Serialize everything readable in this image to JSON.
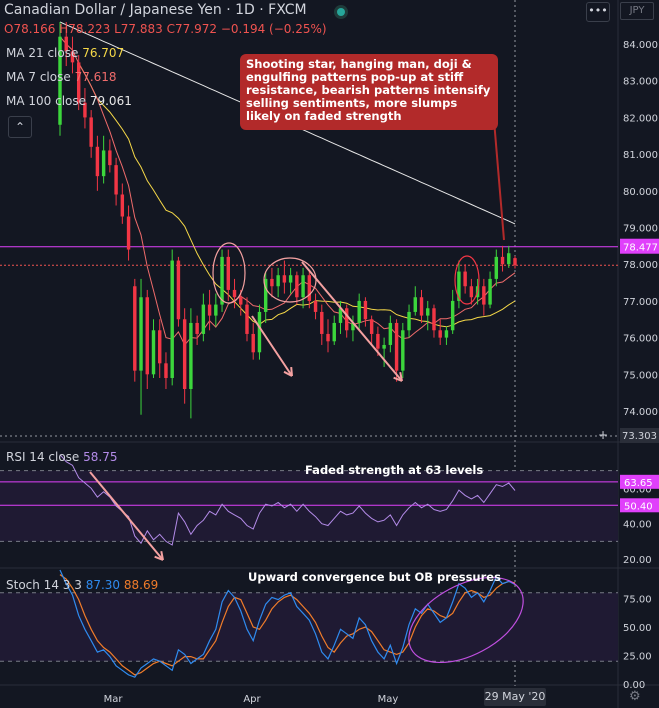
{
  "header": {
    "title": "Canadian Dollar / Japanese Yen · 1D · FXCM",
    "currency": "JPY",
    "ohlc": {
      "o": "O78.166",
      "h": "H78.223",
      "l": "L77.883",
      "c": "C77.972",
      "chg": "−0.194 (−0.25%)"
    }
  },
  "indicators": {
    "ma21": {
      "label": "MA 21 close",
      "value": "76.707",
      "color": "#f5d848"
    },
    "ma7": {
      "label": "MA 7 close",
      "value": "77.618",
      "color": "#ef6b6b"
    },
    "ma100": {
      "label": "MA 100 close",
      "value": "79.061",
      "color": "#e8e8e8"
    },
    "rsi": {
      "label": "RSI 14 close",
      "value": "58.75",
      "color": "#b38be8"
    },
    "stoch": {
      "label": "Stoch 14 3 3",
      "k": "87.30",
      "d": "88.69",
      "k_color": "#2f8bef",
      "d_color": "#f07c2a"
    }
  },
  "annotations": {
    "callout": "Shooting star, hanging man, doji & engulfing patterns pop-up at stiff resistance, bearish patterns intensify selling sentiments, more slumps likely on faded strength",
    "rsi_note": "Faded strength at 63 levels",
    "stoch_note": "Upward convergence but OB pressures"
  },
  "chart_data": [
    {
      "type": "candlestick",
      "pane": "price",
      "y_ticks": [
        "84.000",
        "83.000",
        "82.000",
        "81.000",
        "80.000",
        "79.000",
        "78.000",
        "77.000",
        "76.000",
        "75.000",
        "74.000"
      ],
      "ylim": [
        73.3,
        84.6
      ],
      "price_labels": {
        "resistance": "78.477",
        "low": "73.303"
      },
      "resistance": 78.477,
      "current": 77.972,
      "x_labels": [
        "Mar",
        "Apr",
        "May"
      ],
      "cursor_date": "29 May '20",
      "candles": [
        [
          81.8,
          84.6,
          81.5,
          84.2
        ],
        [
          84.2,
          84.6,
          83.4,
          83.8
        ],
        [
          83.8,
          84.2,
          83.2,
          83.5
        ],
        [
          83.5,
          83.7,
          82.2,
          82.4
        ],
        [
          82.4,
          82.8,
          81.7,
          82.0
        ],
        [
          82.0,
          82.2,
          80.9,
          81.2
        ],
        [
          81.2,
          81.5,
          80.0,
          80.4
        ],
        [
          80.4,
          81.5,
          80.2,
          81.1
        ],
        [
          81.1,
          81.4,
          80.5,
          80.7
        ],
        [
          80.7,
          80.9,
          79.6,
          79.9
        ],
        [
          79.9,
          80.2,
          79.1,
          79.3
        ],
        [
          79.3,
          79.6,
          78.1,
          78.4
        ],
        [
          77.4,
          77.6,
          74.8,
          75.1
        ],
        [
          75.1,
          77.6,
          73.9,
          77.1
        ],
        [
          77.1,
          77.3,
          74.6,
          75.0
        ],
        [
          75.0,
          76.5,
          74.9,
          76.2
        ],
        [
          76.2,
          76.5,
          74.9,
          75.3
        ],
        [
          75.3,
          75.6,
          74.6,
          74.9
        ],
        [
          74.9,
          78.4,
          74.7,
          78.1
        ],
        [
          78.1,
          78.2,
          76.3,
          76.5
        ],
        [
          76.5,
          76.8,
          74.2,
          74.6
        ],
        [
          74.6,
          76.8,
          73.8,
          76.4
        ],
        [
          76.4,
          76.6,
          75.8,
          76.1
        ],
        [
          76.1,
          77.2,
          75.9,
          76.9
        ],
        [
          76.9,
          77.3,
          76.2,
          76.6
        ],
        [
          76.6,
          77.2,
          76.3,
          76.9
        ],
        [
          76.9,
          78.4,
          76.7,
          78.2
        ],
        [
          78.2,
          78.4,
          77.0,
          77.3
        ],
        [
          77.3,
          77.6,
          76.8,
          77.1
        ],
        [
          77.1,
          77.3,
          76.6,
          76.9
        ],
        [
          76.9,
          77.1,
          75.9,
          76.1
        ],
        [
          76.1,
          76.4,
          75.4,
          75.6
        ],
        [
          75.6,
          76.9,
          75.4,
          76.7
        ],
        [
          76.7,
          77.8,
          76.4,
          77.6
        ],
        [
          77.6,
          77.9,
          77.1,
          77.4
        ],
        [
          77.4,
          77.9,
          77.1,
          77.7
        ],
        [
          77.7,
          78.1,
          77.2,
          77.5
        ],
        [
          77.5,
          77.9,
          77.2,
          77.7
        ],
        [
          77.7,
          77.8,
          76.9,
          77.1
        ],
        [
          77.1,
          77.9,
          76.8,
          77.7
        ],
        [
          77.7,
          77.8,
          76.8,
          77.0
        ],
        [
          77.0,
          77.2,
          76.5,
          76.7
        ],
        [
          76.7,
          76.9,
          75.8,
          76.1
        ],
        [
          76.1,
          76.5,
          75.6,
          75.9
        ],
        [
          75.9,
          76.6,
          75.8,
          76.4
        ],
        [
          76.4,
          77.0,
          76.1,
          76.8
        ],
        [
          76.8,
          76.9,
          76.0,
          76.2
        ],
        [
          76.2,
          76.6,
          75.9,
          76.4
        ],
        [
          76.4,
          77.2,
          76.2,
          77.0
        ],
        [
          77.0,
          77.1,
          76.3,
          76.5
        ],
        [
          76.5,
          76.6,
          75.8,
          76.1
        ],
        [
          76.1,
          76.3,
          75.5,
          75.7
        ],
        [
          75.7,
          76.0,
          75.2,
          75.8
        ],
        [
          75.8,
          76.6,
          75.6,
          76.4
        ],
        [
          76.4,
          76.5,
          74.8,
          75.1
        ],
        [
          75.1,
          76.4,
          74.9,
          76.2
        ],
        [
          76.2,
          76.9,
          76.0,
          76.7
        ],
        [
          76.7,
          77.4,
          76.6,
          77.1
        ],
        [
          77.1,
          77.3,
          76.4,
          76.6
        ],
        [
          76.6,
          77.0,
          76.2,
          76.8
        ],
        [
          76.8,
          76.9,
          76.0,
          76.2
        ],
        [
          76.2,
          76.5,
          75.8,
          76.0
        ],
        [
          76.0,
          76.3,
          75.8,
          76.2
        ],
        [
          76.2,
          77.3,
          76.1,
          77.0
        ],
        [
          77.0,
          78.1,
          76.8,
          77.8
        ],
        [
          77.8,
          78.0,
          77.2,
          77.4
        ],
        [
          77.4,
          77.6,
          76.9,
          77.1
        ],
        [
          77.1,
          77.6,
          76.9,
          77.4
        ],
        [
          77.4,
          77.6,
          76.6,
          76.9
        ],
        [
          76.9,
          77.8,
          76.8,
          77.6
        ],
        [
          77.6,
          78.4,
          77.4,
          78.2
        ],
        [
          78.2,
          78.5,
          77.8,
          78.0
        ],
        [
          78.0,
          78.5,
          77.9,
          78.3
        ],
        [
          78.166,
          78.223,
          77.883,
          77.972
        ]
      ]
    },
    {
      "type": "line",
      "pane": "rsi",
      "y_ticks": [
        "60.00",
        "40.00",
        "20.00"
      ],
      "ylim": [
        15,
        85
      ],
      "levels": [
        70,
        30
      ],
      "marked_levels": [
        "63.65",
        "50.40"
      ],
      "series": [
        {
          "name": "RSI 14 close",
          "values": [
            79,
            75,
            73,
            66,
            63,
            60,
            55,
            58,
            55,
            50,
            47,
            44,
            33,
            29,
            36,
            31,
            34,
            30,
            28,
            46,
            41,
            34,
            39,
            42,
            47,
            45,
            51,
            47,
            45,
            43,
            39,
            37,
            46,
            51,
            50,
            52,
            49,
            51,
            47,
            51,
            47,
            44,
            40,
            39,
            43,
            47,
            45,
            46,
            50,
            46,
            43,
            41,
            42,
            45,
            39,
            45,
            49,
            52,
            49,
            51,
            48,
            47,
            48,
            53,
            59,
            56,
            54,
            56,
            52,
            57,
            62,
            61,
            63,
            58.75
          ]
        }
      ]
    },
    {
      "type": "line",
      "pane": "stoch",
      "y_ticks": [
        "75.00",
        "50.00",
        "25.00",
        "0.00"
      ],
      "ylim": [
        0,
        100
      ],
      "levels": [
        80,
        20
      ],
      "series": [
        {
          "name": "%K",
          "values": [
            100,
            88,
            78,
            60,
            48,
            38,
            28,
            30,
            24,
            16,
            12,
            8,
            6,
            14,
            18,
            22,
            20,
            16,
            12,
            30,
            26,
            18,
            22,
            26,
            38,
            48,
            72,
            82,
            76,
            64,
            48,
            38,
            56,
            70,
            76,
            74,
            78,
            80,
            68,
            62,
            56,
            44,
            28,
            22,
            34,
            48,
            44,
            40,
            58,
            52,
            38,
            28,
            22,
            34,
            18,
            32,
            52,
            66,
            62,
            70,
            62,
            54,
            58,
            72,
            88,
            84,
            76,
            80,
            72,
            82,
            94,
            88,
            90,
            87.3
          ]
        },
        {
          "name": "%D",
          "values": [
            96,
            92,
            84,
            74,
            60,
            48,
            38,
            32,
            28,
            22,
            16,
            12,
            8,
            10,
            14,
            18,
            20,
            18,
            16,
            20,
            24,
            24,
            22,
            22,
            30,
            38,
            54,
            68,
            76,
            74,
            62,
            50,
            48,
            56,
            66,
            72,
            76,
            78,
            74,
            68,
            62,
            54,
            42,
            32,
            28,
            36,
            42,
            44,
            48,
            50,
            46,
            38,
            30,
            28,
            26,
            28,
            36,
            50,
            60,
            66,
            64,
            60,
            58,
            62,
            72,
            80,
            82,
            80,
            76,
            78,
            84,
            88,
            90,
            88.69
          ]
        }
      ]
    }
  ]
}
